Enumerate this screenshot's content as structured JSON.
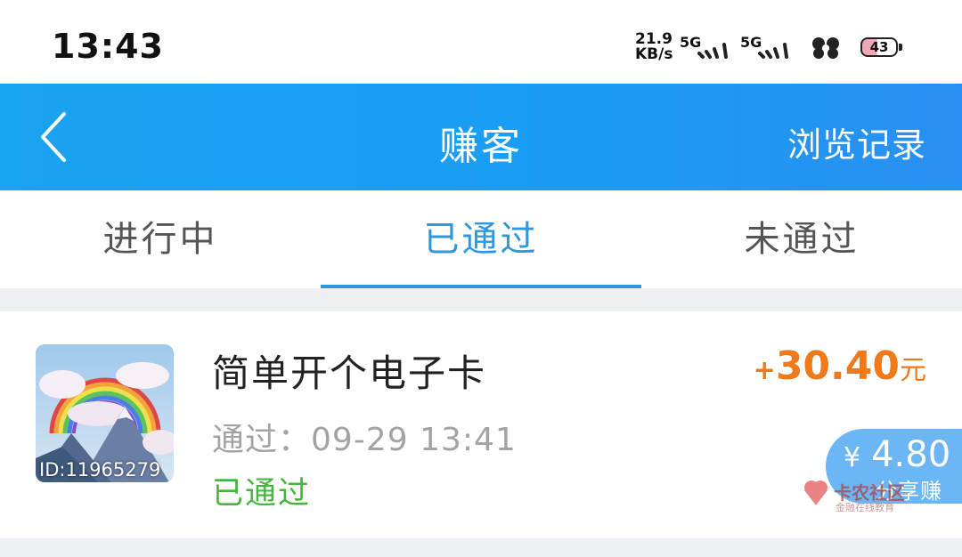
{
  "status_bar": {
    "time": "13:43",
    "net_speed_value": "21.9",
    "net_speed_unit": "KB/s",
    "signal1_label": "5G",
    "signal2_label": "5G",
    "battery": "43",
    "battery_level": 0.43
  },
  "header": {
    "title": "赚客",
    "right_link": "浏览记录",
    "back_icon": "chevron-left-icon",
    "color": "#1aa3f0"
  },
  "tabs": [
    {
      "label": "进行中",
      "active": false
    },
    {
      "label": "已通过",
      "active": true
    },
    {
      "label": "未通过",
      "active": false
    }
  ],
  "task": {
    "image_id": "ID:11965279",
    "title": "简单开个电子卡",
    "time_label": "通过：",
    "time": "09-29 13:41",
    "status": "已通过",
    "reward_sign": "+",
    "reward_amount": "30.40",
    "reward_unit": "元"
  },
  "share": {
    "currency": "¥",
    "amount": "4.80",
    "label": "分享赚"
  },
  "watermark": {
    "text": "卡农社区",
    "sub": "金融在线教育"
  },
  "colors": {
    "accent": "#2d98e0",
    "reward": "#f07a19",
    "status_ok": "#44b63c",
    "share_badge": "#6db6f5"
  }
}
